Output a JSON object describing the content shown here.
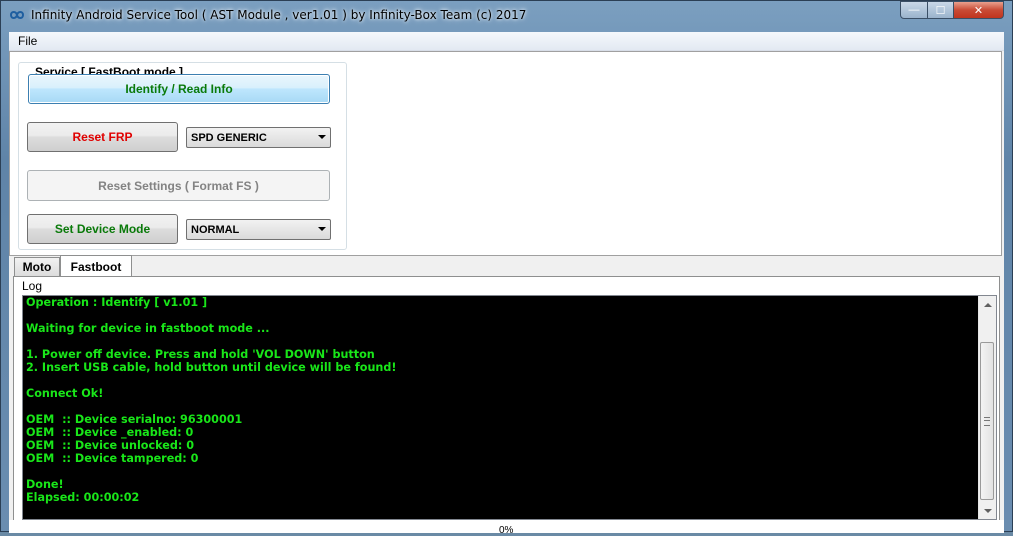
{
  "window": {
    "title": "Infinity Android Service Tool ( AST Module , ver1.01  ) by Infinity-Box Team (c) 2017",
    "min_glyph": "—",
    "max_glyph": "☐",
    "close_glyph": "✕"
  },
  "menu": {
    "file": "File"
  },
  "service": {
    "group_title": "Service [ FastBoot mode ]",
    "identify_label": "Identify / Read Info",
    "reset_frp_label": "Reset FRP",
    "reset_frp_select": "SPD GENERIC",
    "reset_settings_label": "Reset Settings ( Format FS )",
    "set_mode_label": "Set Device Mode",
    "set_mode_select": "NORMAL"
  },
  "tabs": [
    {
      "label": "Moto"
    },
    {
      "label": "Fastboot"
    }
  ],
  "log": {
    "label": "Log",
    "lines": [
      "Operation : Identify [ v1.01 ]",
      "",
      "Waiting for device in fastboot mode ...",
      "",
      "1. Power off device. Press and hold 'VOL DOWN' button",
      "2. Insert USB cable, hold button until device will be found!",
      "",
      "Connect Ok!",
      "",
      "OEM  :: Device serialno: 96300001",
      "OEM  :: Device _enabled: 0",
      "OEM  :: Device unlocked: 0",
      "OEM  :: Device tampered: 0",
      "",
      "Done!",
      "Elapsed: 00:00:02"
    ]
  },
  "status": {
    "progress": "0%"
  },
  "colors": {
    "log_text": "#19e619",
    "green_label": "#0a7a0a",
    "red_label": "#e00000"
  },
  "icons": {
    "app": "infinity-icon",
    "minimize": "minimize-icon",
    "maximize": "maximize-icon",
    "close": "close-icon"
  }
}
